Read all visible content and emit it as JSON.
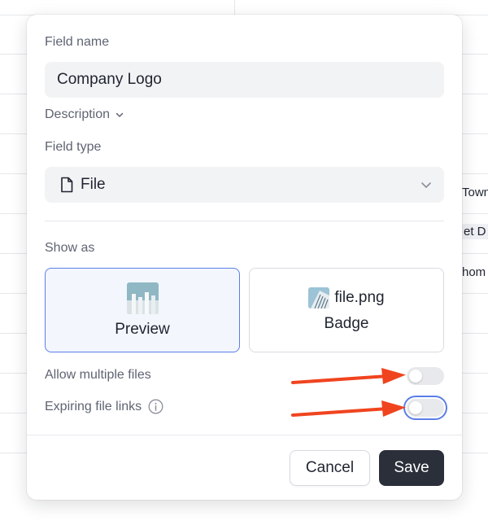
{
  "background": {
    "cells": [
      "Town",
      "et D",
      "hom"
    ]
  },
  "modal": {
    "field_name": {
      "label": "Field name",
      "value": "Company Logo"
    },
    "description_label": "Description",
    "field_type": {
      "label": "Field type",
      "value": "File",
      "icon": "file-icon"
    },
    "show_as": {
      "label": "Show as",
      "options": [
        {
          "label": "Preview",
          "selected": true
        },
        {
          "label": "Badge",
          "filename": "file.png",
          "selected": false
        }
      ]
    },
    "toggles": [
      {
        "label": "Allow multiple files",
        "on": false
      },
      {
        "label": "Expiring file links",
        "on": false,
        "has_info": true
      }
    ],
    "buttons": {
      "cancel": "Cancel",
      "save": "Save"
    }
  },
  "colors": {
    "accent": "#5b7ee8",
    "save_bg": "#2b2f3a",
    "annotation_arrow": "#f0441f"
  }
}
